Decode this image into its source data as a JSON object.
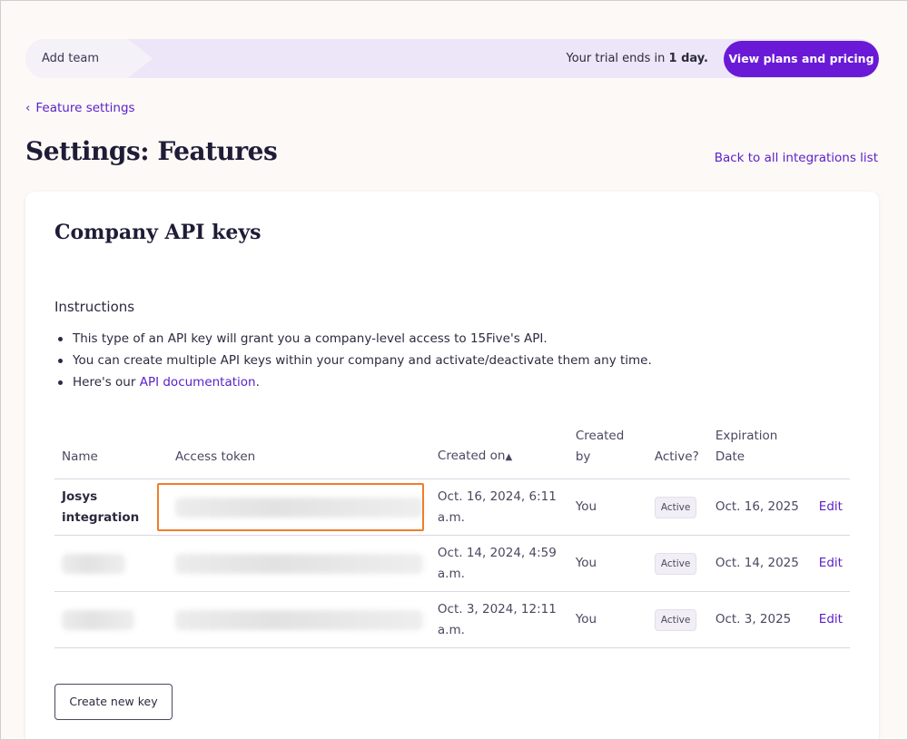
{
  "banner": {
    "add_team": "Add team",
    "trial_prefix": "Your trial ends in ",
    "trial_bold": "1 day.",
    "plans_button": "View plans and pricing"
  },
  "breadcrumb": {
    "chevron": "‹",
    "label": "Feature settings"
  },
  "page_title": "Settings: Features",
  "back_link": "Back to all integrations list",
  "card": {
    "title": "Company API keys",
    "instructions_title": "Instructions",
    "bullets": [
      "This type of an API key will grant you a company-level access to 15Five's API.",
      "You can create multiple API keys within your company and activate/deactivate them any time.",
      "Here's our "
    ],
    "api_doc_link": "API documentation",
    "bullet3_suffix": "."
  },
  "table": {
    "headers": {
      "name": "Name",
      "token": "Access token",
      "created_on": "Created on",
      "sort_indicator": "▲",
      "created_by": "Created by",
      "active": "Active?",
      "expiration": "Expiration Date"
    },
    "rows": [
      {
        "name": "Josys integration",
        "created_on": "Oct. 16, 2024, 6:11 a.m.",
        "created_by": "You",
        "status": "Active",
        "expiration": "Oct. 16, 2025",
        "edit": "Edit"
      },
      {
        "name": "",
        "created_on": "Oct. 14, 2024, 4:59 a.m.",
        "created_by": "You",
        "status": "Active",
        "expiration": "Oct. 14, 2025",
        "edit": "Edit"
      },
      {
        "name": "",
        "created_on": "Oct. 3, 2024, 12:11 a.m.",
        "created_by": "You",
        "status": "Active",
        "expiration": "Oct. 3, 2025",
        "edit": "Edit"
      }
    ]
  },
  "create_button": "Create new key",
  "colors": {
    "accent": "#6a19d6",
    "link": "#5b21c9",
    "highlight": "#ef7d2a",
    "background": "#fdf9f7"
  }
}
